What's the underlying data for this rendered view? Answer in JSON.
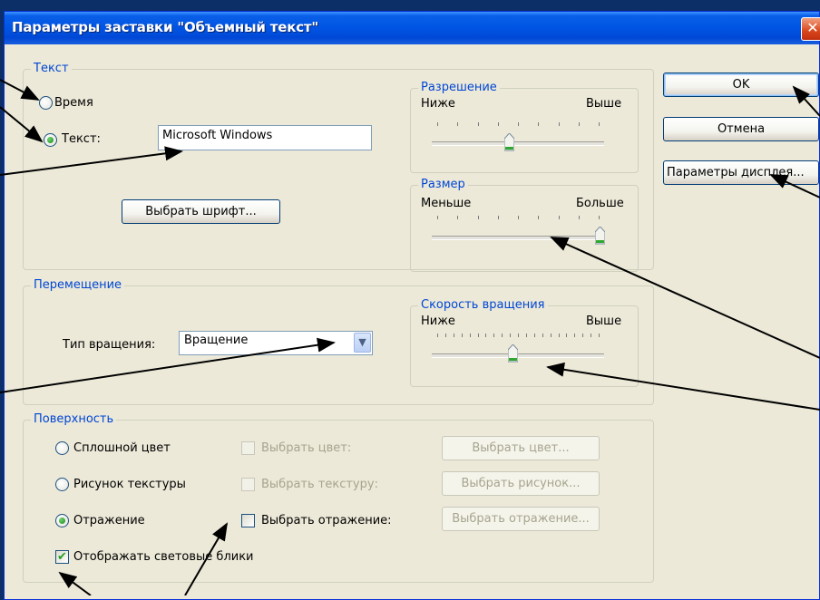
{
  "window": {
    "title": "Параметры заставки \"Объемный текст\"",
    "close_glyph": "✕"
  },
  "text_group": {
    "legend": "Текст",
    "time_label": "Время",
    "text_label": "Текст:",
    "text_value": "Microsoft Windows",
    "font_button": "Выбрать шрифт..."
  },
  "resolution": {
    "legend": "Разрешение",
    "low": "Ниже",
    "high": "Выше",
    "value_fraction": 0.5
  },
  "size": {
    "legend": "Размер",
    "low": "Меньше",
    "high": "Больше",
    "value_fraction": 1.0
  },
  "movement": {
    "legend": "Перемещение",
    "rotation_type_label": "Тип вращения:",
    "rotation_type_value": "Вращение"
  },
  "rotation_speed": {
    "legend": "Скорость вращения",
    "low": "Ниже",
    "high": "Выше",
    "value_fraction": 0.5
  },
  "surface": {
    "legend": "Поверхность",
    "solid_color": "Сплошной цвет",
    "texture": "Рисунок текстуры",
    "reflection": "Отражение",
    "choose_color_chk": "Выбрать цвет:",
    "choose_texture_chk": "Выбрать текстуру:",
    "choose_reflection_chk": "Выбрать отражение:",
    "choose_color_btn": "Выбрать цвет...",
    "choose_picture_btn": "Выбрать рисунок...",
    "choose_reflection_btn": "Выбрать отражение...",
    "highlights": "Отображать световые блики",
    "selected": "Отражение"
  },
  "buttons": {
    "ok": "OK",
    "cancel": "Отмена",
    "display": "Параметры дисплея..."
  },
  "colors": {
    "legend_blue": "#0046d5",
    "titlebar": "#0054e3",
    "background": "#ece9d8"
  }
}
